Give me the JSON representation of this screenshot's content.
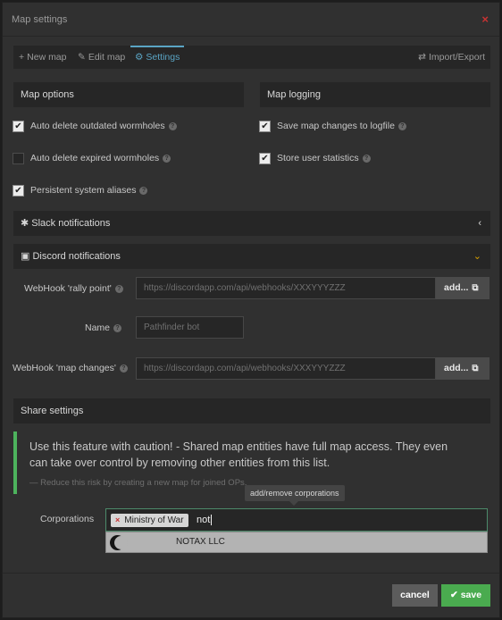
{
  "dialog": {
    "title": "Map settings",
    "close_icon": "×"
  },
  "tabs": {
    "new_map": {
      "icon": "+",
      "label": "New map"
    },
    "edit_map": {
      "icon": "✎",
      "label": "Edit map"
    },
    "settings": {
      "icon": "⚙",
      "label": "Settings"
    },
    "import_export": {
      "icon": "⇄",
      "label": "Import/Export"
    }
  },
  "map_options": {
    "title": "Map options",
    "items": [
      {
        "label": "Auto delete outdated wormholes",
        "checked": true
      },
      {
        "label": "Auto delete expired wormholes",
        "checked": false
      },
      {
        "label": "Persistent system aliases",
        "checked": true
      }
    ]
  },
  "map_logging": {
    "title": "Map logging",
    "items": [
      {
        "label": "Save map changes to logfile",
        "checked": true
      },
      {
        "label": "Store user statistics",
        "checked": true
      }
    ]
  },
  "slack": {
    "title": "Slack notifications",
    "icon": "✱",
    "caret": "‹"
  },
  "discord": {
    "title": "Discord notifications",
    "icon": "▣",
    "caret": "⌄",
    "webhook_rally_label": "WebHook 'rally point'",
    "webhook_rally_placeholder": "https://discordapp.com/api/webhooks/XXXYYYZZZ",
    "name_label": "Name",
    "name_placeholder": "Pathfinder bot",
    "webhook_changes_label": "WebHook 'map changes'",
    "webhook_changes_placeholder": "https://discordapp.com/api/webhooks/XXXYYYZZZ",
    "add_label": "add...",
    "add_icon": "⧉"
  },
  "share": {
    "title": "Share settings",
    "warning": "Use this feature with caution! - Shared map entities have full map access. They even can take over control by removing other entities from this list.",
    "note": "— Reduce this risk by creating a new map for joined OPs.",
    "tooltip": "add/remove corporations",
    "corporations_label": "Corporations",
    "selected_tag": "Ministry of War",
    "tag_remove": "×",
    "search_text": "not",
    "result_option": "NOTAX LLC"
  },
  "footer": {
    "cancel_label": "cancel",
    "save_label": "save",
    "save_icon": "✔"
  },
  "help_glyph": "?",
  "check_glyph": "✔",
  "colors": {
    "accent": "#5aa4c4",
    "success": "#4aab4f",
    "danger": "#c83232"
  }
}
